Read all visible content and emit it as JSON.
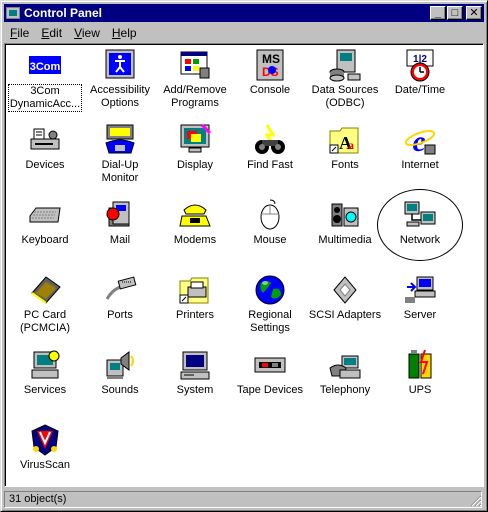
{
  "window": {
    "title": "Control Panel",
    "minimize": "_",
    "maximize": "□",
    "close": "✕"
  },
  "menu": [
    {
      "underline": "F",
      "rest": "ile"
    },
    {
      "underline": "E",
      "rest": "dit"
    },
    {
      "underline": "V",
      "rest": "iew"
    },
    {
      "underline": "H",
      "rest": "elp"
    }
  ],
  "items": [
    {
      "name": "3com",
      "icon": "3com-logo-icon",
      "line1": "3Com",
      "line2": "DynamicAcc..."
    },
    {
      "name": "accessibility-options",
      "icon": "accessibility-icon",
      "line1": "Accessibility",
      "line2": "Options"
    },
    {
      "name": "add-remove-programs",
      "icon": "add-remove-programs-icon",
      "line1": "Add/Remove",
      "line2": "Programs"
    },
    {
      "name": "console",
      "icon": "msdos-console-icon",
      "line1": "Console",
      "line2": ""
    },
    {
      "name": "data-sources",
      "icon": "odbc-database-icon",
      "line1": "Data Sources",
      "line2": "(ODBC)"
    },
    {
      "name": "date-time",
      "icon": "calendar-clock-icon",
      "line1": "Date/Time",
      "line2": ""
    },
    {
      "name": "devices",
      "icon": "devices-icon",
      "line1": "Devices",
      "line2": ""
    },
    {
      "name": "dial-up-monitor",
      "icon": "telephone-icon",
      "line1": "Dial-Up",
      "line2": "Monitor"
    },
    {
      "name": "display",
      "icon": "display-monitor-icon",
      "line1": "Display",
      "line2": ""
    },
    {
      "name": "find-fast",
      "icon": "binoculars-icon",
      "line1": "Find Fast",
      "line2": ""
    },
    {
      "name": "fonts",
      "icon": "fonts-folder-icon",
      "line1": "Fonts",
      "line2": ""
    },
    {
      "name": "internet",
      "icon": "internet-explorer-icon",
      "line1": "Internet",
      "line2": ""
    },
    {
      "name": "keyboard",
      "icon": "keyboard-icon",
      "line1": "Keyboard",
      "line2": ""
    },
    {
      "name": "mail",
      "icon": "mail-icon",
      "line1": "Mail",
      "line2": ""
    },
    {
      "name": "modems",
      "icon": "modem-phone-icon",
      "line1": "Modems",
      "line2": ""
    },
    {
      "name": "mouse",
      "icon": "mouse-icon",
      "line1": "Mouse",
      "line2": ""
    },
    {
      "name": "multimedia",
      "icon": "multimedia-icon",
      "line1": "Multimedia",
      "line2": ""
    },
    {
      "name": "network",
      "icon": "network-computers-icon",
      "line1": "Network",
      "line2": ""
    },
    {
      "name": "pc-card",
      "icon": "pc-card-icon",
      "line1": "PC Card",
      "line2": "(PCMCIA)"
    },
    {
      "name": "ports",
      "icon": "serial-cable-icon",
      "line1": "Ports",
      "line2": ""
    },
    {
      "name": "printers",
      "icon": "printers-folder-icon",
      "line1": "Printers",
      "line2": ""
    },
    {
      "name": "regional-settings",
      "icon": "globe-icon",
      "line1": "Regional",
      "line2": "Settings"
    },
    {
      "name": "scsi-adapters",
      "icon": "scsi-icon",
      "line1": "SCSI Adapters",
      "line2": ""
    },
    {
      "name": "server",
      "icon": "server-computer-icon",
      "line1": "Server",
      "line2": ""
    },
    {
      "name": "services",
      "icon": "services-computer-icon",
      "line1": "Services",
      "line2": ""
    },
    {
      "name": "sounds",
      "icon": "speaker-sounds-icon",
      "line1": "Sounds",
      "line2": ""
    },
    {
      "name": "system",
      "icon": "system-computer-icon",
      "line1": "System",
      "line2": ""
    },
    {
      "name": "tape-devices",
      "icon": "tape-drive-icon",
      "line1": "Tape Devices",
      "line2": ""
    },
    {
      "name": "telephony",
      "icon": "telephony-icon",
      "line1": "Telephony",
      "line2": ""
    },
    {
      "name": "ups",
      "icon": "ups-battery-icon",
      "line1": "UPS",
      "line2": ""
    },
    {
      "name": "virusscan",
      "icon": "virusscan-shield-icon",
      "line1": "VirusScan",
      "line2": ""
    }
  ],
  "status": {
    "text": "31 object(s)"
  }
}
